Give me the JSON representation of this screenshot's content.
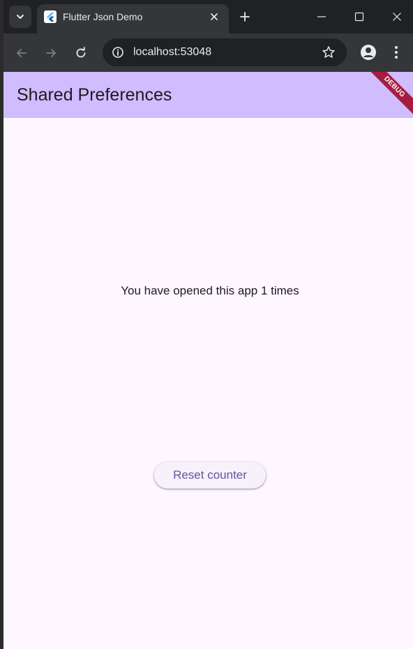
{
  "browser": {
    "tab": {
      "title": "Flutter Json Demo",
      "favicon": "flutter-icon"
    },
    "address_bar": {
      "url": "localhost:53048"
    },
    "icons": {
      "tab_search": "chevron-down-icon",
      "tab_close": "close-icon",
      "new_tab": "plus-icon",
      "minimize": "minimize-icon",
      "maximize": "maximize-icon",
      "window_close": "close-icon",
      "back": "arrow-left-icon",
      "forward": "arrow-right-icon",
      "reload": "reload-icon",
      "site_info": "info-icon",
      "bookmark": "star-icon",
      "profile": "person-icon",
      "menu": "more-vert-icon"
    }
  },
  "app": {
    "appbar": {
      "title": "Shared Preferences"
    },
    "debug_banner": "DEBUG",
    "counter_text": "You have opened this app 1 times",
    "reset_button_label": "Reset counter"
  },
  "colors": {
    "appbar_bg": "#d0bcff",
    "page_bg": "#fef7ff",
    "button_text": "#6750a4",
    "debug_banner": "#a51d40",
    "browser_dark": "#202124",
    "browser_toolbar": "#35363a"
  }
}
